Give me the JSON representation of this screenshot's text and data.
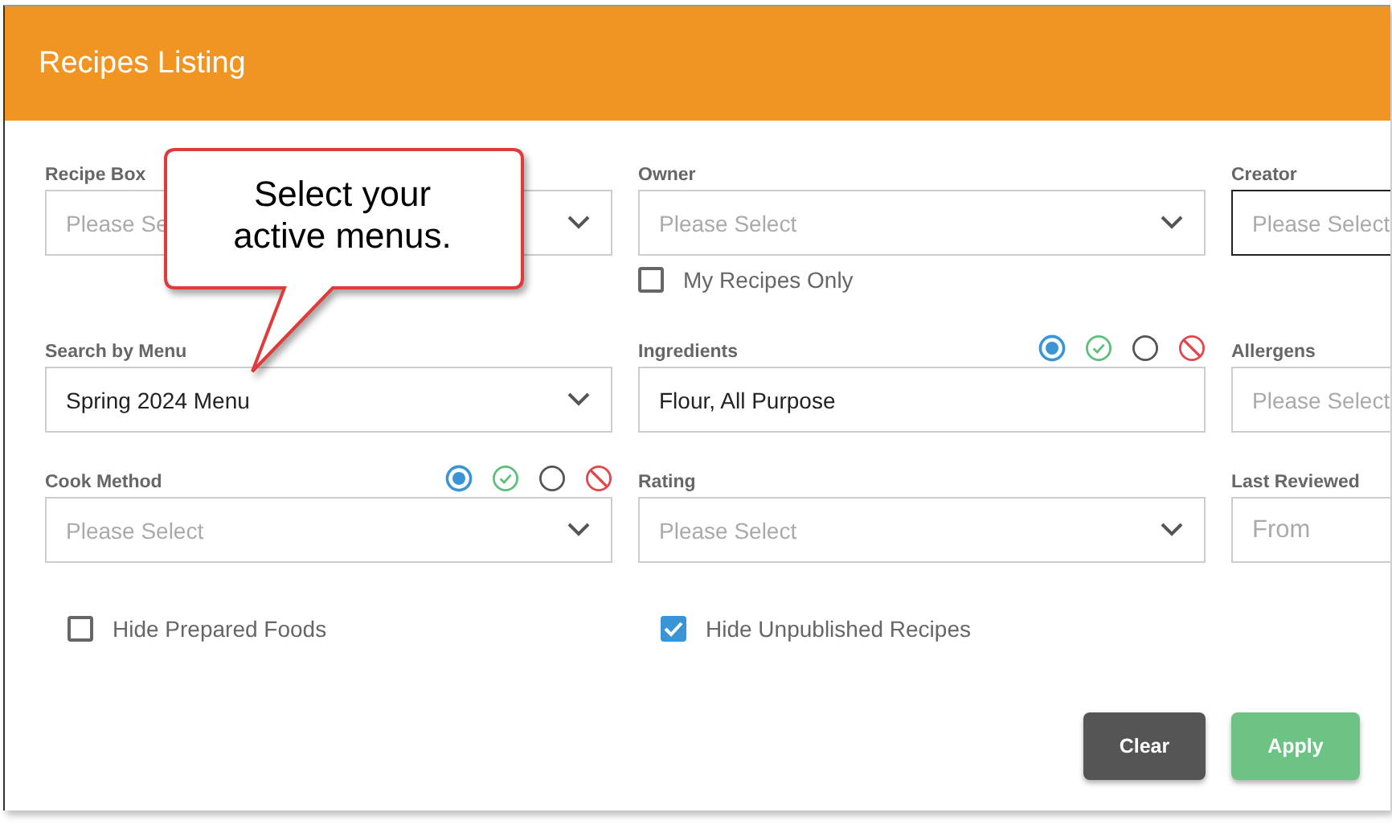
{
  "header": {
    "title": "Recipes Listing"
  },
  "fields": [
    {
      "label": "Recipe Box",
      "kind": "select",
      "placeholder": "Please Se"
    },
    {
      "label": "Owner",
      "kind": "select",
      "placeholder": "Please Select",
      "checkbox": {
        "label": "My Recipes Only",
        "checked": false
      }
    },
    {
      "label": "Creator",
      "kind": "input",
      "focused": true,
      "placeholder": "Please Select"
    },
    {
      "label": "Search by Menu",
      "kind": "select",
      "value": "Spring 2024 Menu"
    },
    {
      "label": "Ingredients",
      "kind": "input",
      "value": "Flour, All Purpose",
      "modes": [
        {
          "kind": "any",
          "selected": true
        },
        {
          "kind": "include",
          "selected": false
        },
        {
          "kind": "neutral",
          "selected": false
        },
        {
          "kind": "exclude",
          "selected": false
        }
      ]
    },
    {
      "label": "Allergens",
      "kind": "input",
      "placeholder": "Please Select"
    },
    {
      "label": "Cook Method",
      "kind": "select",
      "placeholder": "Please Select",
      "modes": [
        {
          "kind": "any",
          "selected": true
        },
        {
          "kind": "include",
          "selected": false
        },
        {
          "kind": "neutral",
          "selected": false
        },
        {
          "kind": "exclude",
          "selected": false
        }
      ]
    },
    {
      "label": "Rating",
      "kind": "select",
      "placeholder": "Please Select"
    },
    {
      "label": "Last Reviewed",
      "kind": "date",
      "placeholder": "From"
    }
  ],
  "options": [
    {
      "label": "Hide Prepared Foods",
      "checked": false
    },
    {
      "label": "Hide Unpublished Recipes",
      "checked": true
    }
  ],
  "buttons": [
    {
      "label": "Clear",
      "kind": "secondary"
    },
    {
      "label": "Apply",
      "kind": "primary"
    }
  ],
  "callout": {
    "text": "Select your active menus."
  }
}
